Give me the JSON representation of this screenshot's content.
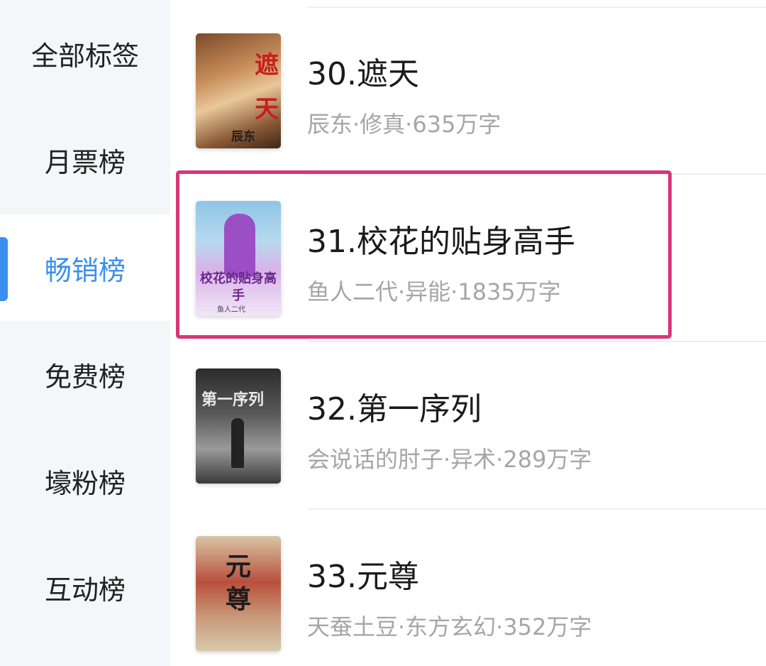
{
  "sidebar": {
    "items": [
      {
        "label": "全部标签"
      },
      {
        "label": "月票榜"
      },
      {
        "label": "畅销榜"
      },
      {
        "label": "免费榜"
      },
      {
        "label": "壕粉榜"
      },
      {
        "label": "互动榜"
      }
    ],
    "active_index": 2
  },
  "books": [
    {
      "title": "30.遮天",
      "meta": "辰东·修真·635万字",
      "cover_text": "遮天",
      "cover_author": "辰东",
      "cover_icon": "book-cover-zhetian"
    },
    {
      "title": "31.校花的贴身高手",
      "meta": "鱼人二代·异能·1835万字",
      "cover_text": "校花的贴身高手",
      "cover_author": "鱼人二代",
      "cover_icon": "book-cover-xiaohua"
    },
    {
      "title": "32.第一序列",
      "meta": "会说话的肘子·异术·289万字",
      "cover_text": "第一序列",
      "cover_icon": "book-cover-diyixulie"
    },
    {
      "title": "33.元尊",
      "meta": "天蚕土豆·东方玄幻·352万字",
      "cover_text": "元尊",
      "cover_icon": "book-cover-yuanzun"
    }
  ],
  "colors": {
    "accent": "#3b8ff0",
    "highlight_border": "#d8367a",
    "meta_text": "#a6a6a6"
  }
}
